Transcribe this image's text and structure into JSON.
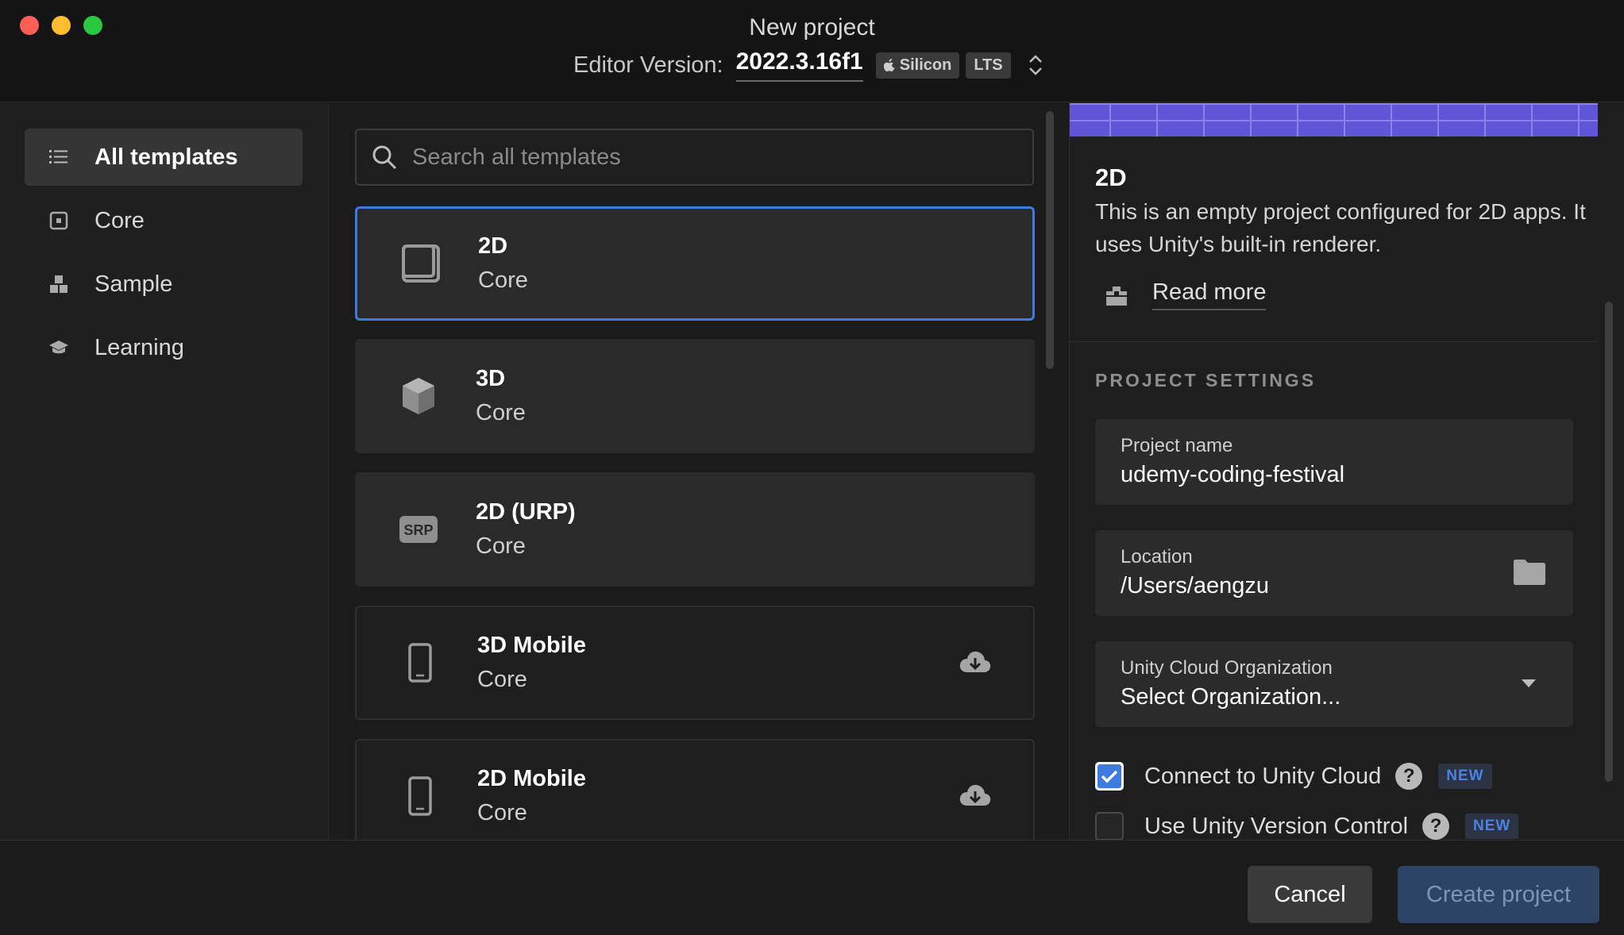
{
  "window": {
    "title": "New project",
    "editor_label": "Editor Version:",
    "editor_version": "2022.3.16f1",
    "tag_silicon": "Silicon",
    "tag_lts": "LTS"
  },
  "sidebar": {
    "items": [
      {
        "label": "All templates",
        "icon": "list-icon"
      },
      {
        "label": "Core",
        "icon": "core-icon"
      },
      {
        "label": "Sample",
        "icon": "sample-icon"
      },
      {
        "label": "Learning",
        "icon": "learning-icon"
      }
    ]
  },
  "search": {
    "placeholder": "Search all templates"
  },
  "templates": [
    {
      "name": "2D",
      "category": "Core",
      "icon": "2d-square-icon"
    },
    {
      "name": "3D",
      "category": "Core",
      "icon": "cube-icon"
    },
    {
      "name": "2D (URP)",
      "category": "Core",
      "icon": "srp-icon",
      "icon_text": "SRP"
    },
    {
      "name": "3D Mobile",
      "category": "Core",
      "icon": "mobile-icon"
    },
    {
      "name": "2D Mobile",
      "category": "Core",
      "icon": "mobile-icon"
    }
  ],
  "details": {
    "title": "2D",
    "description": "This is an empty project configured for 2D apps. It uses Unity's built-in renderer.",
    "read_more": "Read more",
    "section_heading": "PROJECT SETTINGS",
    "project_name_label": "Project name",
    "project_name_value": "udemy-coding-festival",
    "location_label": "Location",
    "location_value": "/Users/aengzu",
    "org_label": "Unity Cloud Organization",
    "org_value": "Select Organization...",
    "connect_cloud_label": "Connect to Unity Cloud",
    "version_control_label": "Use Unity Version Control",
    "help_glyph": "?",
    "new_tag": "NEW"
  },
  "footer": {
    "cancel_label": "Cancel",
    "create_label": "Create project"
  },
  "colors": {
    "accent": "#3d7be0",
    "preview": "#6055d6",
    "create_button": "#2d4466"
  }
}
